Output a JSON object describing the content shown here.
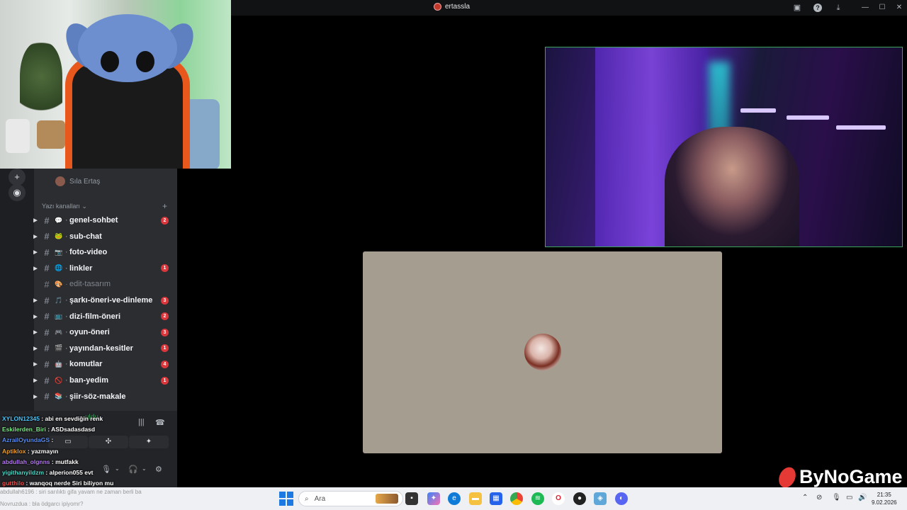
{
  "titlebar": {
    "title": "ertassla",
    "icons": [
      "screen-share-icon",
      "help-icon",
      "download-icon"
    ],
    "window_buttons": [
      "—",
      "☐",
      "✕"
    ]
  },
  "sidebar": {
    "user_name": "Sıla Ertaş",
    "category": "Yazı kanalları",
    "channels": [
      {
        "name": "genel-sohbet",
        "emoji": "💬",
        "badge": "2"
      },
      {
        "name": "sub-chat",
        "emoji": "🐸",
        "badge": ""
      },
      {
        "name": "foto-video",
        "emoji": "📷",
        "badge": ""
      },
      {
        "name": "linkler",
        "emoji": "🌐",
        "badge": "1"
      },
      {
        "name": "edit-tasarım",
        "emoji": "🎨",
        "badge": "",
        "muted": true
      },
      {
        "name": "şarkı-öneri-ve-dinleme",
        "emoji": "🎵",
        "badge": "3"
      },
      {
        "name": "dizi-film-öneri",
        "emoji": "📺",
        "badge": "2"
      },
      {
        "name": "oyun-öneri",
        "emoji": "🎮",
        "badge": "3"
      },
      {
        "name": "yayından-kesitler",
        "emoji": "🎬",
        "badge": "1"
      },
      {
        "name": "komutlar",
        "emoji": "🤖",
        "badge": "4"
      },
      {
        "name": "ban-yedim",
        "emoji": "🚫",
        "badge": "1"
      },
      {
        "name": "şiir-söz-makale",
        "emoji": "📚",
        "badge": ""
      }
    ]
  },
  "chat": [
    {
      "nick": "XYLON12345",
      "color": "#4fc3f7",
      "msg": "abi en sevdiğin renk"
    },
    {
      "nick": "Eskilerden_Biri",
      "color": "#7ee787",
      "msg": "ASDsadasdasd"
    },
    {
      "nick": "AzrailOyundaGS",
      "color": "#5b8def",
      "msg": ""
    },
    {
      "nick": "Aptiklox",
      "color": "#f0a030",
      "msg": "yazmayın"
    },
    {
      "nick": "abdullah_olgnns",
      "color": "#b57cf0",
      "msg": "mutfakk"
    },
    {
      "nick": "yigithanyildzm",
      "color": "#4ad9c8",
      "msg": "alperion055 evt"
    },
    {
      "nick": "gutthilo",
      "color": "#f05050",
      "msg": "wanqoq nerde Siri biliyon mu"
    }
  ],
  "bottom_text": {
    "line1": "abdullah6196 : siri sarılıktı gifa yavam ne zaman berli ba",
    "line2": "Novruzdua : bla ödgarcı ipiyomr?"
  },
  "voice_status": "uldu",
  "watermark": "ByNoGame",
  "taskbar": {
    "search_placeholder": "Ara",
    "time": "21:35",
    "date": "9.02.2026"
  },
  "colors": {
    "discord_bg": "#2b2d31",
    "badge": "#da373c",
    "speaking_border": "#3ba55c",
    "screen_tile": "#a69d91"
  }
}
